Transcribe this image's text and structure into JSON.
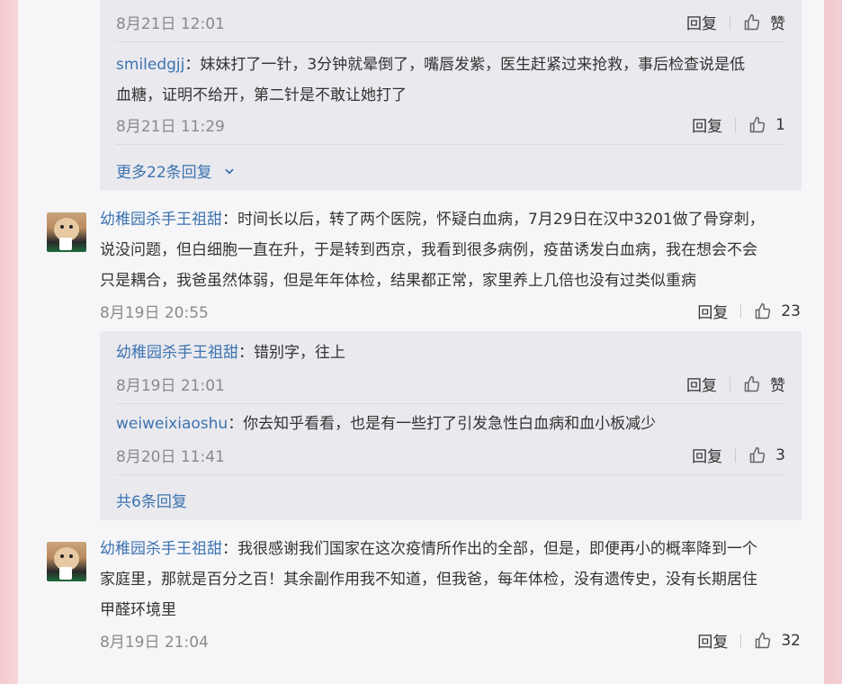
{
  "comments": [
    {
      "replies": [
        {
          "time": "8月21日 12:01",
          "reply_label": "回复",
          "like": "赞"
        },
        {
          "user": "smiledgjj",
          "text_lines": [
            "：妹妹打了一针，3分钟就晕倒了，嘴唇发紫，医生赶紧过来抢救，事后检查说是低",
            "血糖，证明不给开，第二针是不敢让她打了"
          ],
          "time": "8月21日 11:29",
          "reply_label": "回复",
          "like": "1"
        }
      ],
      "more": "更多22条回复"
    },
    {
      "user": "幼稚园杀手王祖甜",
      "text_lines": [
        "：时间长以后，转了两个医院，怀疑白血病，7月29日在汉中3201做了骨穿刺，",
        "说没问题，但白细胞一直在升，于是转到西京，我看到很多病例，疫苗诱发白血病，我在想会不会",
        "只是耦合，我爸虽然体弱，但是年年体检，结果都正常，家里养上几倍也没有过类似重病"
      ],
      "time": "8月19日 20:55",
      "reply_label": "回复",
      "like": "23",
      "replies": [
        {
          "user": "幼稚园杀手王祖甜",
          "text": "：错别字，往上",
          "time": "8月19日 21:01",
          "reply_label": "回复",
          "like": "赞"
        },
        {
          "user": "weiweixiaoshu",
          "text": "：你去知乎看看，也是有一些打了引发急性白血病和血小板减少",
          "time": "8月20日 11:41",
          "reply_label": "回复",
          "like": "3"
        }
      ],
      "more": "共6条回复"
    },
    {
      "user": "幼稚园杀手王祖甜",
      "text_lines": [
        "：我很感谢我们国家在这次疫情所作出的全部，但是，即便再小的概率降到一个",
        "家庭里，那就是百分之百！其余副作用我不知道，但我爸，每年体检，没有遗传史，没有长期居住",
        "甲醛环境里"
      ],
      "time": "8月19日 21:04",
      "reply_label": "回复",
      "like": "32"
    }
  ]
}
